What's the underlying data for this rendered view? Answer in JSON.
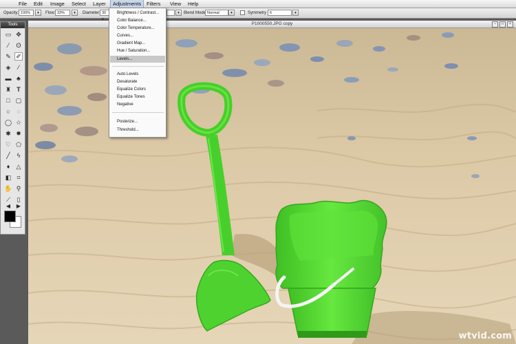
{
  "menu": [
    "File",
    "Edit",
    "Image",
    "Select",
    "Layer",
    "Adjustments",
    "Filters",
    "View",
    "Help"
  ],
  "active_menu": "Adjustments",
  "options": {
    "opacity_label": "Opacity:",
    "opacity_value": "100%",
    "flow_label": "Flow:",
    "flow_value": "33%",
    "diameter_label": "Diameter:",
    "diameter_value": "30 p",
    "blend_mode_label": "Blend Mode:",
    "blend_mode_value": "Normal",
    "symmetry_label": "Symmetry",
    "symmetry_value": "6"
  },
  "tools_panel": {
    "title": "Tools"
  },
  "document": {
    "title": "P1000550.JPG copy"
  },
  "adjustments_menu": {
    "group1": [
      "Brightness / Contrast...",
      "Color Balance...",
      "Color Temperature...",
      "Curves...",
      "Gradient Map...",
      "Hue / Saturation...",
      "Levels..."
    ],
    "highlighted": "Levels...",
    "group2": [
      "Auto Levels",
      "Desaturate",
      "Equalize Colors",
      "Equalize Tones",
      "Negative"
    ],
    "group3": [
      "Posterize...",
      "Threshold..."
    ]
  },
  "watermark": "wtvid.com",
  "colors": {
    "sand": "#d9c7a3",
    "toy_green": "#55dd33",
    "menu_highlight": "#c9d7ea",
    "item_highlight": "#c8c8c8"
  }
}
